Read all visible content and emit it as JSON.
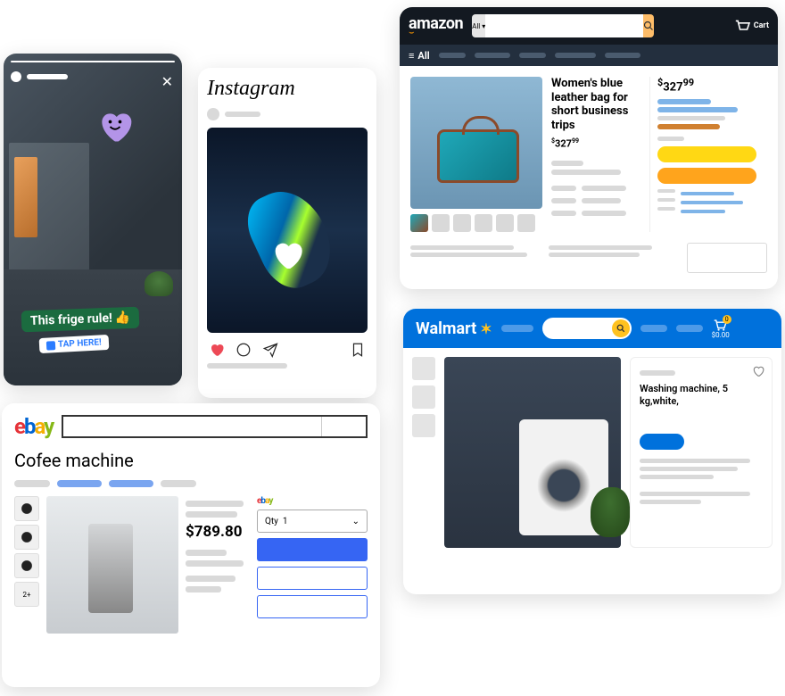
{
  "story": {
    "tag_text": "This frige rule!",
    "tag_emoji": "👍",
    "tap_label": "TAP HERE!",
    "close": "✕"
  },
  "instagram": {
    "brand": "Instagram"
  },
  "amazon": {
    "brand": "amazon",
    "search_filter": "All",
    "cart_label": "Cart",
    "menu_all": "All",
    "product_title": "Women's blue leather bag for short business trips",
    "price_main": "327",
    "price_cents": "99",
    "price_side": "327",
    "price_side_cents": "99"
  },
  "walmart": {
    "brand": "Walmart",
    "cart_total": "$0.00",
    "cart_badge": "0",
    "product_title": "Washing machine, 5 kg,white,"
  },
  "ebay": {
    "brand_r": "e",
    "brand_b": "b",
    "brand_y": "a",
    "brand_g": "y",
    "title": "Cofee machine",
    "price": "$789.80",
    "qty_label": "Qty",
    "qty_value": "1",
    "more_thumb": "2+"
  }
}
